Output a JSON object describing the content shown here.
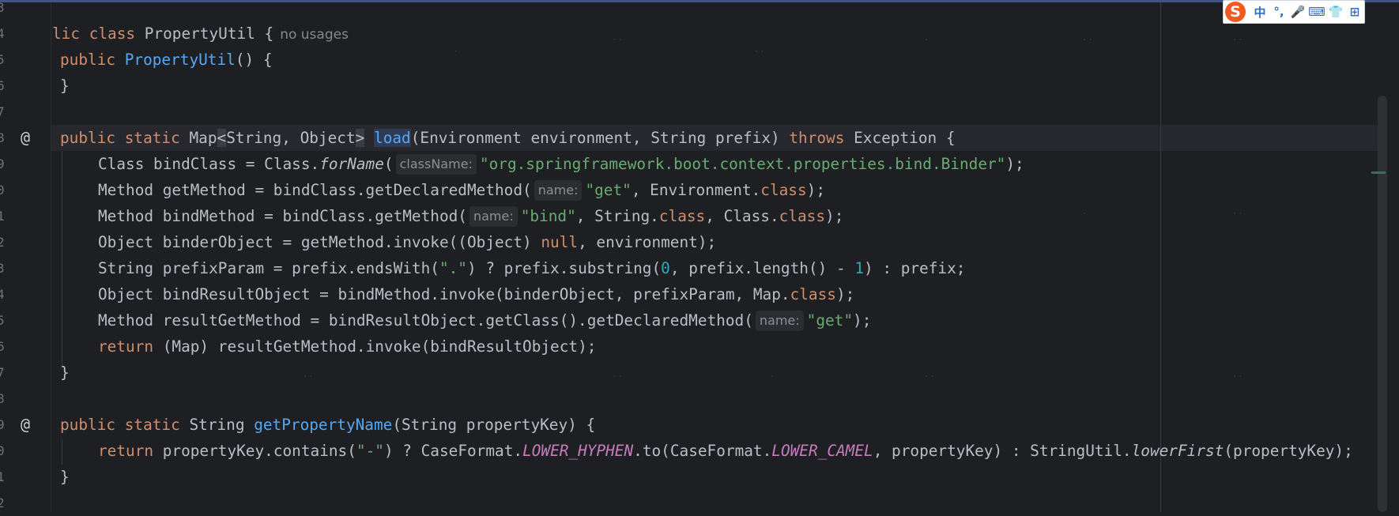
{
  "colors": {
    "background": "#1e1f22",
    "keyword": "#cf8e6d",
    "function": "#56a8f5",
    "string": "#6aab73",
    "number": "#2aacb8",
    "constant": "#c77dbb",
    "text": "#bcbec4"
  },
  "gutter": {
    "line_numbers": [
      "3",
      "4",
      "5",
      "6",
      "7",
      "8",
      "9",
      "0",
      "1",
      "2",
      "3",
      "4",
      "5",
      "6",
      "7",
      "8",
      "9",
      "0",
      "1",
      "2"
    ],
    "at_icon": "@"
  },
  "code": {
    "l4": {
      "kw1": "lic ",
      "kw2": "class ",
      "name": "PropertyUtil {",
      "usages": "no usages"
    },
    "l5": {
      "kw": "public ",
      "fn": "PropertyUtil",
      "rest": "() {"
    },
    "l6": {
      "text": "}"
    },
    "l8": {
      "kw1": "public ",
      "kw2": "static ",
      "t1": "Map",
      "lt": "<",
      "t2": "String, Object",
      "gt": ">",
      "fn": "load",
      "params": "(Environment environment, String prefix) ",
      "throws": "throws ",
      "rest": "Exception {"
    },
    "l9": {
      "a": "Class bindClass = Class.",
      "m": "forName",
      "b": "(",
      "hint": "className:",
      "str": "\"org.springframework.boot.context.properties.bind.Binder\"",
      "c": ");"
    },
    "l10": {
      "a": "Method getMethod = bindClass.getDeclaredMethod(",
      "hint": "name:",
      "str": "\"get\"",
      "b": ", Environment.",
      "kw": "class",
      "c": ");"
    },
    "l11": {
      "a": "Method bindMethod = bindClass.getMethod(",
      "hint": "name:",
      "str": "\"bind\"",
      "b": ", String.",
      "kw1": "class",
      "c": ", Class.",
      "kw2": "class",
      "d": ");"
    },
    "l12": {
      "a": "Object binderObject = getMethod.invoke((Object) ",
      "kw": "null",
      "b": ", environment);"
    },
    "l13": {
      "a": "String prefixParam = prefix.endsWith(",
      "str": "\".\"",
      "b": ") ? prefix.substring(",
      "n1": "0",
      "c": ", prefix.length() - ",
      "n2": "1",
      "d": ") : prefix;"
    },
    "l14": {
      "a": "Object bindResultObject = bindMethod.invoke(binderObject, prefixParam, Map.",
      "kw": "class",
      "b": ");"
    },
    "l15": {
      "a": "Method resultGetMethod = bindResultObject.getClass().getDeclaredMethod(",
      "hint": "name:",
      "str": "\"get\"",
      "b": ");"
    },
    "l16": {
      "kw": "return ",
      "a": "(Map) resultGetMethod.invoke(bindResultObject);"
    },
    "l17": {
      "text": "}"
    },
    "l19": {
      "kw1": "public ",
      "kw2": "static ",
      "t": "String ",
      "fn": "getPropertyName",
      "rest": "(String propertyKey) {"
    },
    "l20": {
      "kw": "return ",
      "a": "propertyKey.contains(",
      "str": "\"-\"",
      "b": ") ? CaseFormat.",
      "c1": "LOWER_HYPHEN",
      "c": ".to(CaseFormat.",
      "c2": "LOWER_CAMEL",
      "d": ", propertyKey) : StringUtil.",
      "m": "lowerFirst",
      "e": "(propertyKey);"
    },
    "l21": {
      "text": "}"
    }
  },
  "ime_toolbar": {
    "logo": "S",
    "items": [
      "中",
      "°,",
      "🎤",
      "⌨",
      "👕",
      "⊞"
    ]
  }
}
